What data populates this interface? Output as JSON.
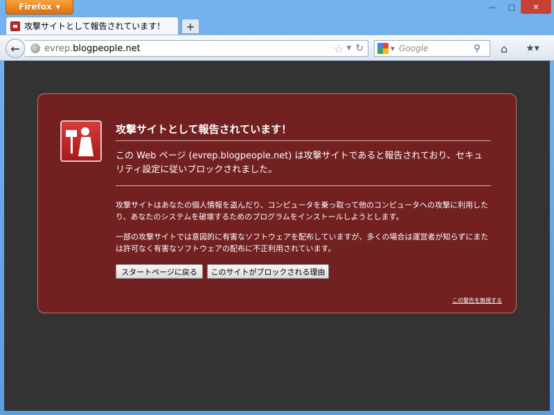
{
  "titlebar": {
    "app_button_label": "Firefox",
    "minimize": "—",
    "maximize": "□",
    "close": "✕"
  },
  "tabs": [
    {
      "label": "攻撃サイトとして報告されています！",
      "icon": "block-site-icon"
    }
  ],
  "new_tab_label": "+",
  "navbar": {
    "url_prefix": "evrep.",
    "url_host": "blogpeople.net",
    "search_placeholder": "Google"
  },
  "page": {
    "title": "攻撃サイトとして報告されています！",
    "lead": "この Web ページ (evrep.blogpeople.net) は攻撃サイトであると報告されており、セキュリティ設定に従いブロックされました。",
    "para1": "攻撃サイトはあなたの個人情報を盗んだり、コンピュータを乗っ取って他のコンピュータへの攻撃に利用したり、あなたのシステムを破壊するためのプログラムをインストールしようとします。",
    "para2": "一部の攻撃サイトでは意図的に有害なソフトウェアを配布していますが、多くの場合は運営者が知らずにまたは許可なく有害なソフトウェアの配布に不正利用されています。",
    "button_start": "スタートページに戻る",
    "button_why": "このサイトがブロックされる理由",
    "ignore_link": "この警告を無視する"
  },
  "colors": {
    "panel_bg": "#722020",
    "content_bg": "#333333",
    "firefox_orange": "#e0700f"
  }
}
